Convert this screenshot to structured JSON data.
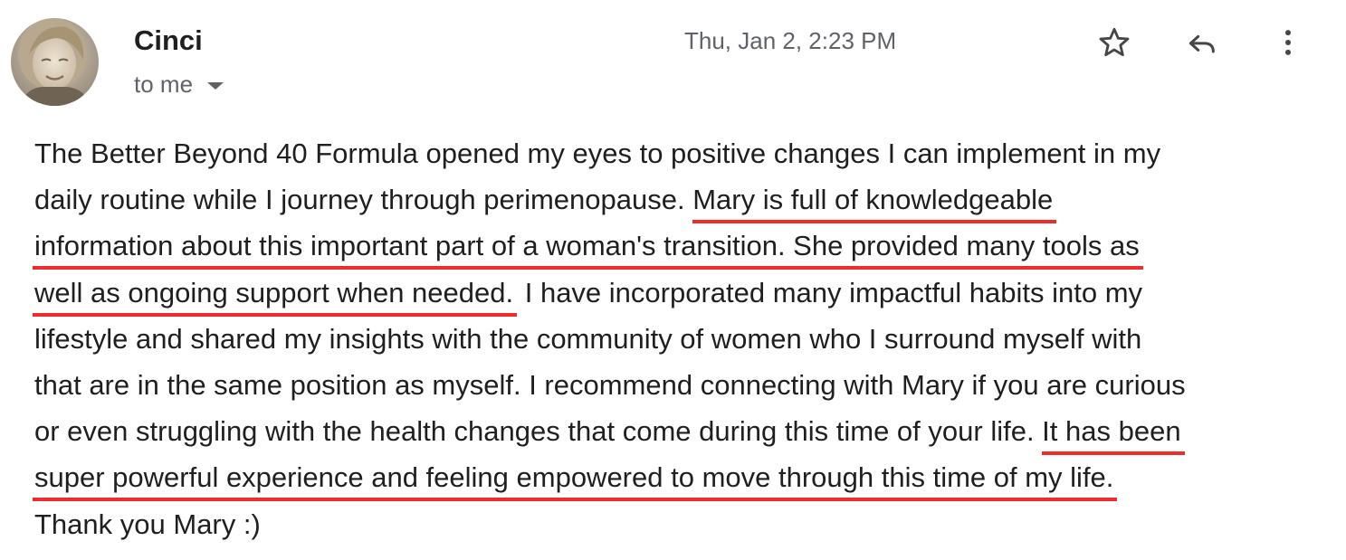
{
  "sender": {
    "name": "Cinci",
    "recipient_label": "to me"
  },
  "date": "Thu, Jan 2, 2:23 PM",
  "icons": {
    "avatar": "avatar",
    "star": "star-icon",
    "reply": "reply-icon",
    "more": "more-vert-icon",
    "caret": "chevron-down-icon"
  },
  "highlight_color": "#ef2b2b",
  "body": {
    "line1": " The Better Beyond 40 Formula opened my eyes to positive changes I can implement in my",
    "line2_plain": "daily routine while I journey through perimenopause. ",
    "line2_hl": "Mary is full of knowledgeable",
    "line3_hl": "information about this important part of a woman's transition. She provided many tools as",
    "line4_hl": "well as ongoing support when needed.",
    "line4_plain": " I have incorporated many impactful habits into my",
    "line5": "lifestyle and shared my insights with the community of women who I surround myself with",
    "line6": "that are in the same position as myself. I recommend connecting with Mary if you are curious",
    "line7_plain": "or even struggling with the health changes that come during this time of your life. ",
    "line7_hl": "It has been",
    "line8_hl": "super powerful experience and feeling empowered to move through this time of my life.",
    "line9": "Thank you Mary :)"
  }
}
